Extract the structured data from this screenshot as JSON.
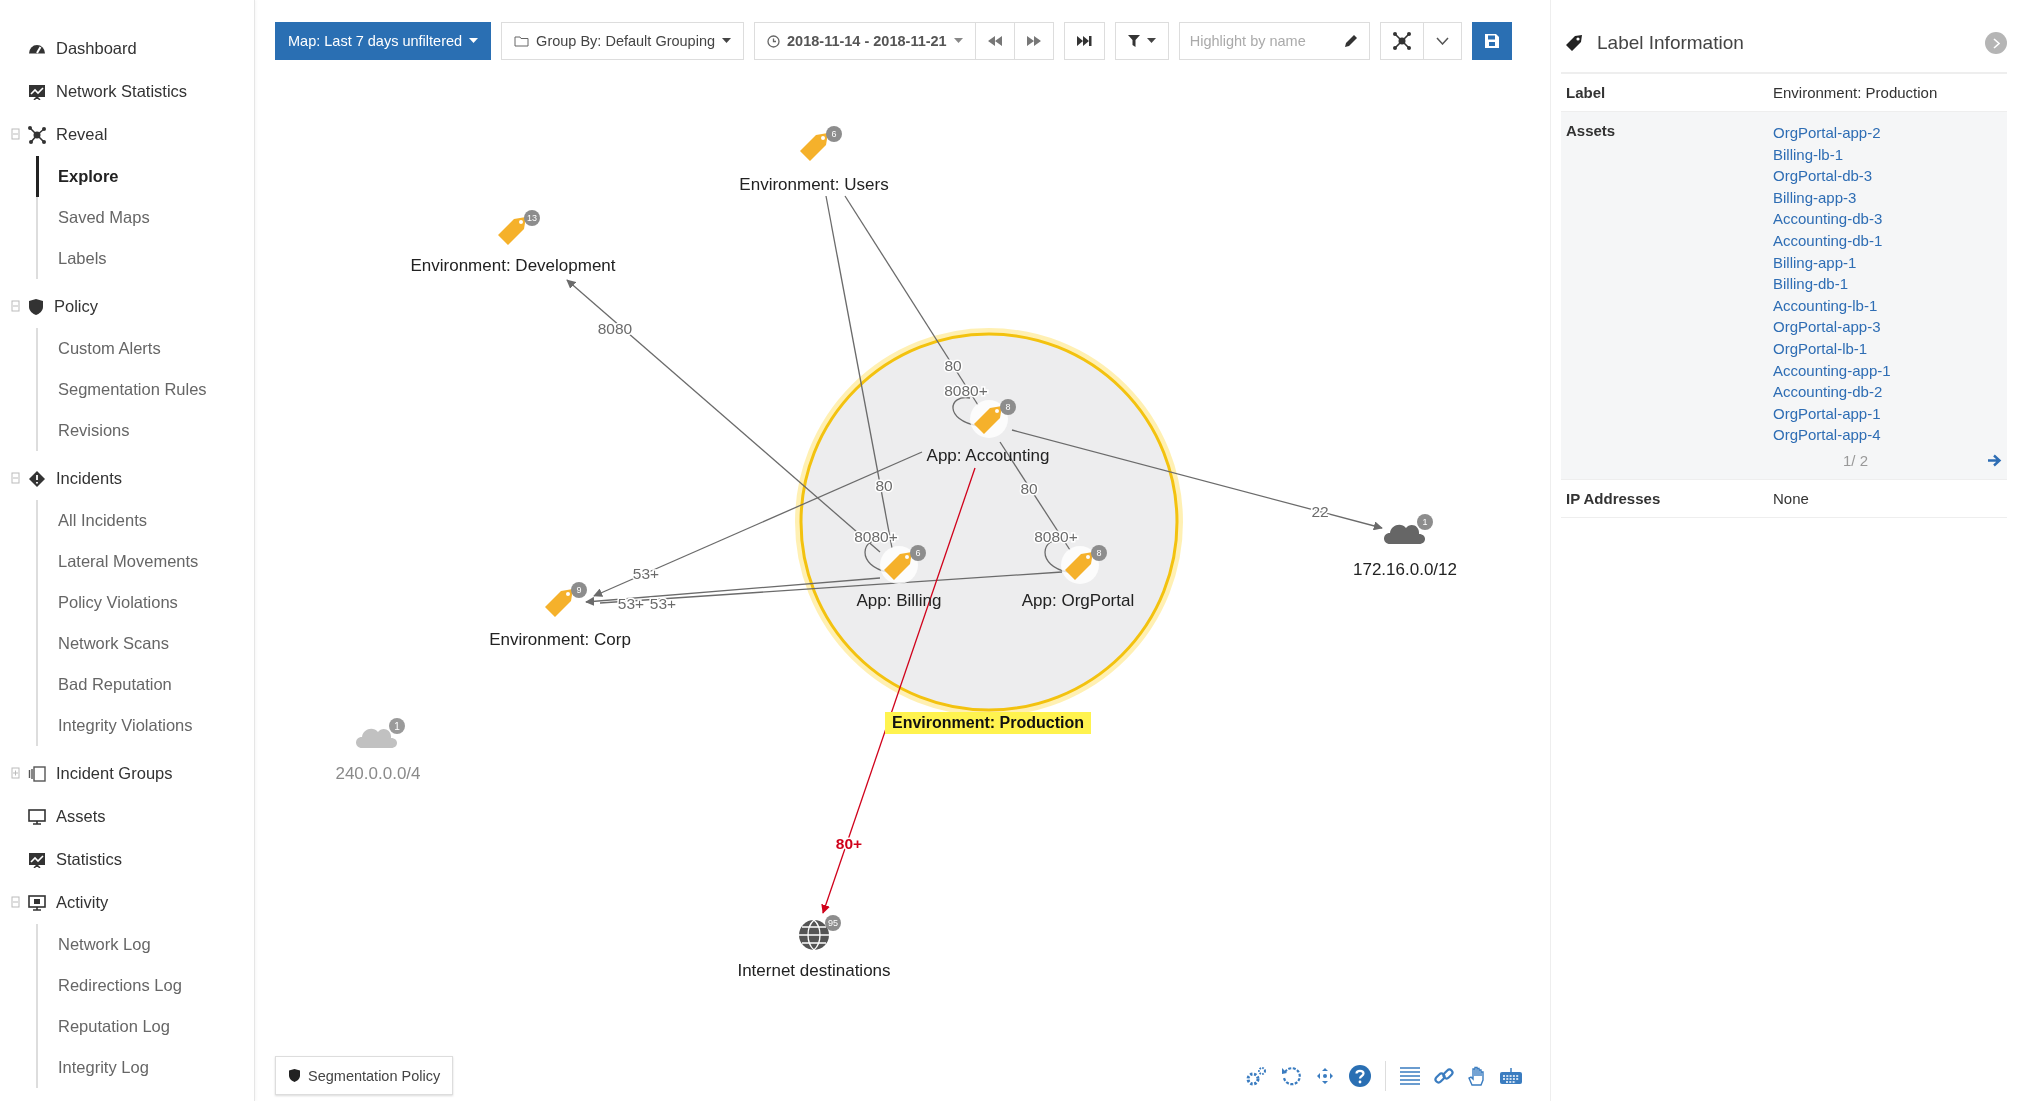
{
  "sidebar": {
    "items": [
      {
        "label": "Dashboard"
      },
      {
        "label": "Network Statistics"
      },
      {
        "label": "Reveal",
        "expanded": true,
        "children": [
          {
            "label": "Explore",
            "selected": true
          },
          {
            "label": "Saved Maps",
            "selected": false
          },
          {
            "label": "Labels",
            "selected": false
          }
        ]
      },
      {
        "label": "Policy",
        "expanded": true,
        "children": [
          {
            "label": "Custom Alerts",
            "selected": false
          },
          {
            "label": "Segmentation Rules",
            "selected": false
          },
          {
            "label": "Revisions",
            "selected": false
          }
        ]
      },
      {
        "label": "Incidents",
        "expanded": true,
        "children": [
          {
            "label": "All Incidents",
            "selected": false
          },
          {
            "label": "Lateral Movements",
            "selected": false
          },
          {
            "label": "Policy Violations",
            "selected": false
          },
          {
            "label": "Network Scans",
            "selected": false
          },
          {
            "label": "Bad Reputation",
            "selected": false
          },
          {
            "label": "Integrity Violations",
            "selected": false
          }
        ]
      },
      {
        "label": "Incident Groups",
        "expanded": false
      },
      {
        "label": "Assets"
      },
      {
        "label": "Statistics"
      },
      {
        "label": "Activity",
        "expanded": true,
        "children": [
          {
            "label": "Network Log",
            "selected": false
          },
          {
            "label": "Redirections Log",
            "selected": false
          },
          {
            "label": "Reputation Log",
            "selected": false
          },
          {
            "label": "Integrity Log",
            "selected": false
          }
        ]
      }
    ]
  },
  "toolbar": {
    "map_button": "Map: Last 7 days unfiltered",
    "group_by": "Group By: Default Grouping",
    "date_range": "2018-11-14 - 2018-11-21",
    "highlight": {
      "placeholder": "Highlight by name"
    }
  },
  "map": {
    "group": {
      "label": "Environment: Production",
      "highlighted": true
    },
    "nodes": [
      {
        "kind": "label",
        "label": "Environment: Users",
        "count": "6",
        "dimmed": false
      },
      {
        "kind": "label",
        "label": "Environment: Development",
        "count": "13",
        "dimmed": false
      },
      {
        "kind": "label",
        "label": "App: Accounting",
        "count": "8",
        "dimmed": false
      },
      {
        "kind": "label",
        "label": "App: Billing",
        "count": "6",
        "dimmed": false
      },
      {
        "kind": "label",
        "label": "App: OrgPortal",
        "count": "8",
        "dimmed": false
      },
      {
        "kind": "label",
        "label": "Environment: Corp",
        "count": "9",
        "dimmed": false
      },
      {
        "kind": "network",
        "label": "172.16.0.0/12",
        "count": "1",
        "dimmed": false
      },
      {
        "kind": "network",
        "label": "240.0.0.0/4",
        "count": "1",
        "dimmed": true
      },
      {
        "kind": "internet",
        "label": "Internet destinations",
        "count": "95",
        "dimmed": false
      }
    ],
    "edges": [
      {
        "label": "8080",
        "color": "#6b6b6b"
      },
      {
        "label": "80",
        "color": "#6b6b6b"
      },
      {
        "label": "8080+",
        "color": "#6b6b6b"
      },
      {
        "label": "80",
        "color": "#6b6b6b"
      },
      {
        "label": "8080+",
        "color": "#6b6b6b"
      },
      {
        "label": "80",
        "color": "#6b6b6b"
      },
      {
        "label": "8080+",
        "color": "#6b6b6b"
      },
      {
        "label": "53+",
        "color": "#6b6b6b"
      },
      {
        "label": "53+",
        "color": "#6b6b6b"
      },
      {
        "label": "53+",
        "color": "#6b6b6b"
      },
      {
        "label": "22",
        "color": "#6b6b6b"
      },
      {
        "label": "80+",
        "color": "#d0021b"
      }
    ],
    "policy_button": "Segmentation Policy"
  },
  "panel": {
    "title": "Label Information",
    "rows": [
      {
        "kind": "text",
        "label": "Label",
        "value": "Environment: Production"
      },
      {
        "kind": "links",
        "label": "Assets",
        "links": [
          "OrgPortal-app-2",
          "Billing-lb-1",
          "OrgPortal-db-3",
          "Billing-app-3",
          "Accounting-db-3",
          "Accounting-db-1",
          "Billing-app-1",
          "Billing-db-1",
          "Accounting-lb-1",
          "OrgPortal-app-3",
          "OrgPortal-lb-1",
          "Accounting-app-1",
          "Accounting-db-2",
          "OrgPortal-app-1",
          "OrgPortal-app-4"
        ],
        "pager": "1/ 2"
      },
      {
        "kind": "text",
        "label": "IP Addresses",
        "value": "None"
      }
    ]
  }
}
